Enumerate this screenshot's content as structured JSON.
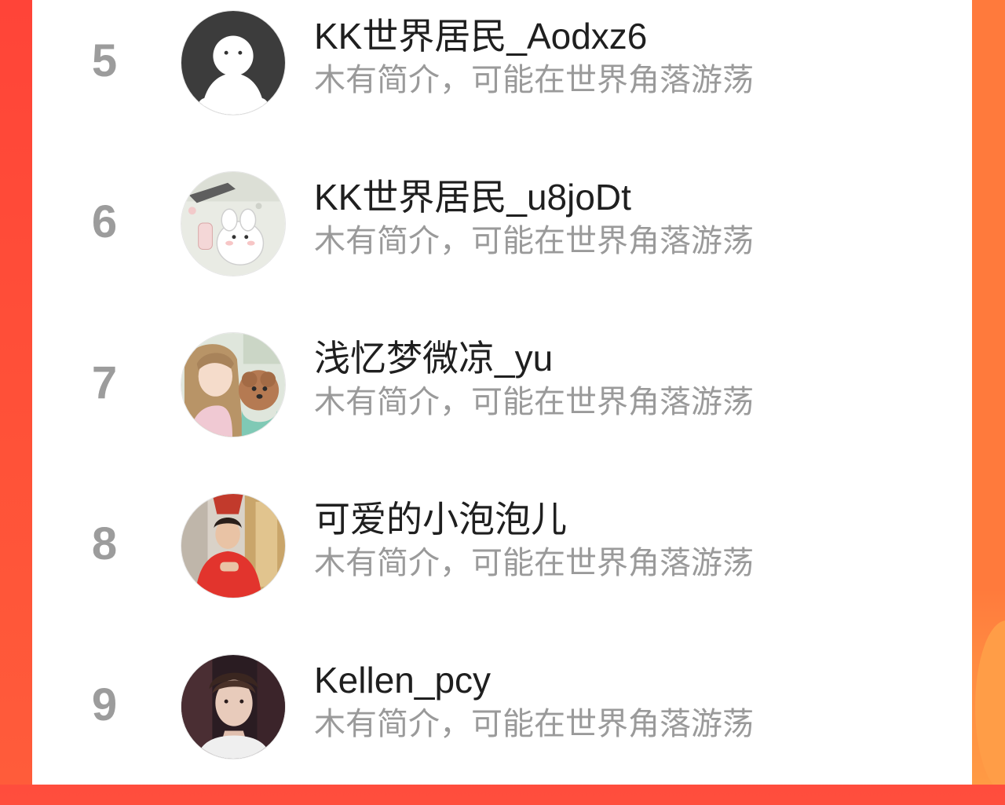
{
  "ranking": {
    "items": [
      {
        "rank": "5",
        "name": "KK世界居民_Aodxz6",
        "bio": "木有简介，可能在世界角落游荡",
        "avatar": "default-avatar-icon"
      },
      {
        "rank": "6",
        "name": "KK世界居民_u8joDt",
        "bio": "木有简介，可能在世界角落游荡",
        "avatar": "cartoon-bunny-avatar"
      },
      {
        "rank": "7",
        "name": "浅忆梦微凉_yu",
        "bio": "木有简介，可能在世界角落游荡",
        "avatar": "girl-with-dog-avatar"
      },
      {
        "rank": "8",
        "name": "可爱的小泡泡儿",
        "bio": "木有简介，可能在世界角落游荡",
        "avatar": "child-red-jacket-avatar"
      },
      {
        "rank": "9",
        "name": "Kellen_pcy",
        "bio": "木有简介，可能在世界角落游荡",
        "avatar": "man-portrait-avatar"
      }
    ]
  },
  "colors": {
    "background_accent": "#ff5a3a",
    "rank_text": "#9c9c9c",
    "name_text": "#1f1f1f",
    "bio_text": "#9a9a9a"
  }
}
